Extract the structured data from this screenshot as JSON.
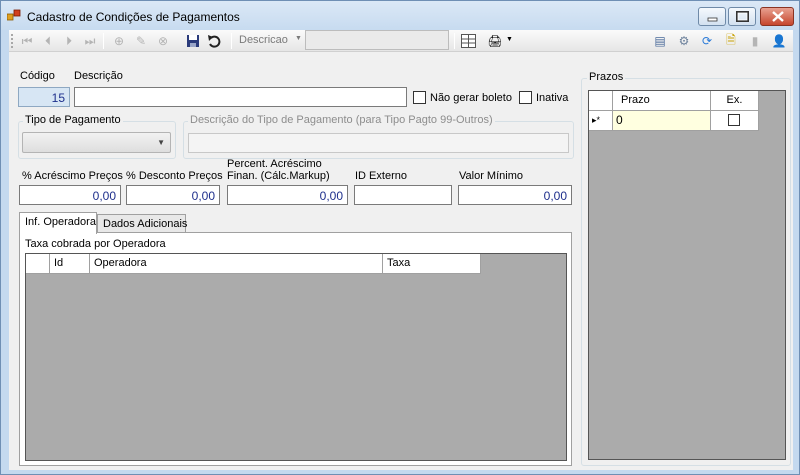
{
  "window": {
    "title": "Cadastro de Condições de Pagamentos"
  },
  "toolbar": {
    "search_label": "Descricao",
    "search_value": ""
  },
  "form": {
    "codigo_label": "Código",
    "codigo_value": "15",
    "descricao_label": "Descrição",
    "descricao_value": "",
    "nao_gerar_boleto_label": "Não gerar boleto",
    "nao_gerar_boleto_checked": false,
    "inativa_label": "Inativa",
    "inativa_checked": false,
    "tipo_pagamento_label": "Tipo de Pagamento",
    "tipo_pagamento_value": "",
    "descricao_tipo_label": "Descrição do Tipo de Pagamento (para Tipo Pagto 99-Outros)",
    "descricao_tipo_value": "",
    "acrescimo_precos_label": "% Acréscimo Preços",
    "acrescimo_precos_value": "0,00",
    "desconto_precos_label": "% Desconto Preços",
    "desconto_precos_value": "0,00",
    "acrescimo_finan_label_1": "Percent. Acréscimo",
    "acrescimo_finan_label_2": "Finan. (Cálc.Markup)",
    "acrescimo_finan_value": "0,00",
    "id_externo_label": "ID Externo",
    "id_externo_value": "",
    "valor_minimo_label": "Valor Mínimo",
    "valor_minimo_value": "0,00"
  },
  "tabs": [
    {
      "label": "Inf. Operadora",
      "active": true
    },
    {
      "label": "Dados Adicionais",
      "active": false
    }
  ],
  "operadora": {
    "caption": "Taxa cobrada por Operadora",
    "columns": [
      "Id",
      "Operadora",
      "Taxa"
    ]
  },
  "prazos": {
    "caption": "Prazos",
    "columns": [
      "Prazo",
      "Ex."
    ],
    "row_marker": "▸*",
    "rows": [
      {
        "prazo": "0",
        "ex": false
      }
    ]
  },
  "colors": {
    "value_text": "#1e2f8c",
    "grid_background": "#ababab",
    "edit_cell": "#ffffe0"
  }
}
